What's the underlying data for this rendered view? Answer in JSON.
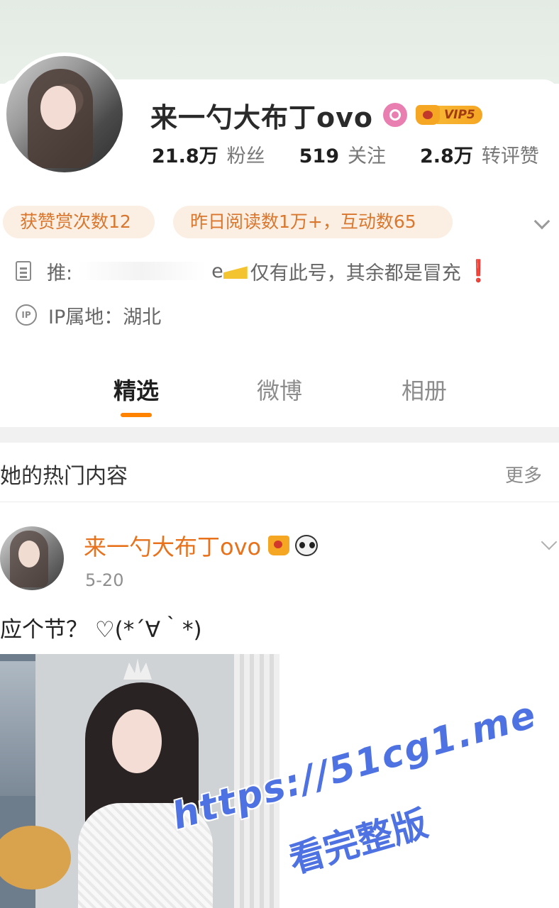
{
  "profile": {
    "username": "来一勺大布丁ovo",
    "vip_label": "VIP5",
    "stats": [
      {
        "value": "21.8万",
        "label": "粉丝"
      },
      {
        "value": "519",
        "label": "关注"
      },
      {
        "value": "2.8万",
        "label": "转评赞"
      }
    ],
    "pills": [
      "获赞赏次数12",
      "昨日阅读数1万+，互动数65"
    ],
    "recommend_prefix": "推:",
    "recommend_suffix": "e",
    "recommend_text": "仅有此号，其余都是冒充",
    "recommend_mark": "❗",
    "ip_location": "IP属地：湖北",
    "ip_icon_text": "IP"
  },
  "tabs": [
    {
      "label": "精选",
      "selected": true
    },
    {
      "label": "微博",
      "selected": false
    },
    {
      "label": "相册",
      "selected": false
    }
  ],
  "section": {
    "title": "她的热门内容",
    "more": "更多"
  },
  "post": {
    "author": "来一勺大布丁ovo",
    "date": "5-20",
    "text": "应个节？ ♡(*´∀｀*)"
  },
  "watermark": {
    "url": "https://51cg1.me",
    "caption": "看完整版"
  },
  "colors": {
    "accent": "#ff8200",
    "name_orange": "#e8721c",
    "pill_bg": "#fbeee3",
    "watermark_blue": "#4f72e3"
  }
}
